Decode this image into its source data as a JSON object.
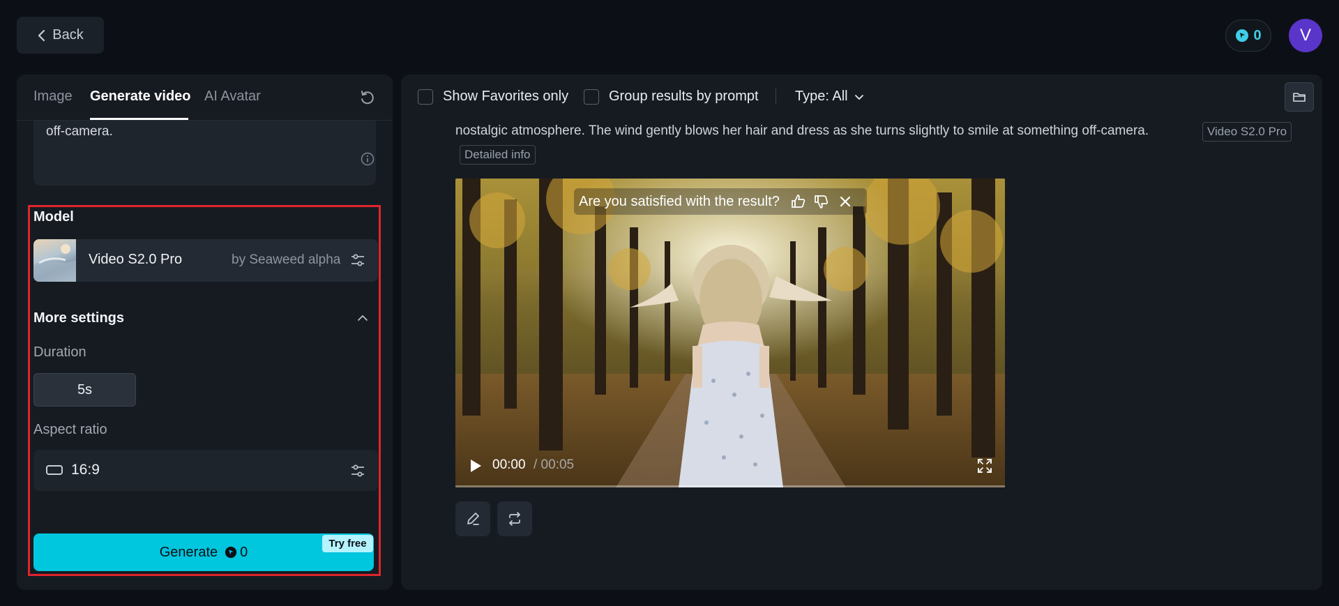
{
  "header": {
    "back_label": "Back",
    "credits": "0",
    "avatar_initial": "V"
  },
  "left": {
    "tabs": [
      {
        "label": "Image"
      },
      {
        "label": "Generate video"
      },
      {
        "label": "AI Avatar"
      }
    ],
    "prompt_text": "off-camera.",
    "model_heading": "Model",
    "model": {
      "name": "Video S2.0 Pro",
      "provider": "by Seaweed alpha"
    },
    "more_settings": "More settings",
    "duration_label": "Duration",
    "duration_value": "5s",
    "aspect_label": "Aspect ratio",
    "aspect_value": "16:9",
    "generate_label": "Generate",
    "generate_cost": "0",
    "try_free": "Try free"
  },
  "right": {
    "show_favorites": "Show Favorites only",
    "group_results": "Group results by prompt",
    "type_filter": "Type: All",
    "prompt_line": "nostalgic atmosphere. The wind gently blows her hair and dress as she turns slightly to smile at something off-camera.",
    "model_tag": "Video S2.0 Pro",
    "detail_tag": "Detailed info",
    "feedback_question": "Are you satisfied with the result?",
    "time_current": "00:00",
    "time_total": "/ 00:05"
  },
  "colors": {
    "accent": "#00c6de",
    "highlight": "#e0242b",
    "avatar": "#5a35c9"
  }
}
